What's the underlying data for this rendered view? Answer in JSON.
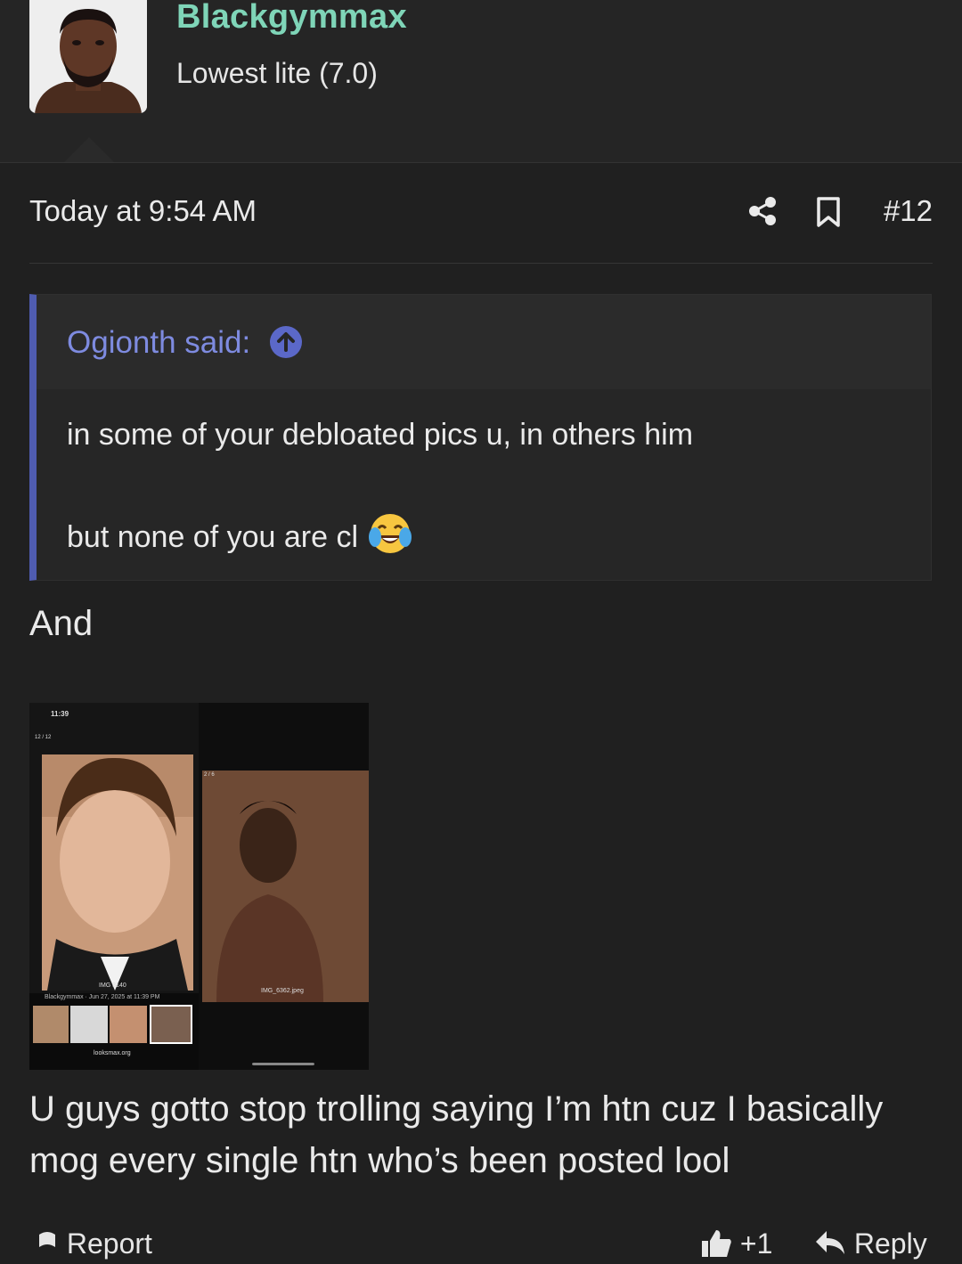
{
  "user": {
    "name": "Blackgymmax",
    "title": "Lowest lite (7.0)",
    "name_color": "#7fd5b8"
  },
  "post": {
    "timestamp": "Today at 9:54 AM",
    "number": "#12",
    "share_icon": "share-icon",
    "bookmark_icon": "bookmark-icon"
  },
  "quote": {
    "author": "Ogionth said:",
    "lines": [
      "in some of your debloated pics u, in others him",
      "but none of you are cl"
    ],
    "emoji": "face-with-tears-of-joy",
    "accent": "#4f5cb0"
  },
  "content": {
    "intro": "And",
    "body": "U guys gotto stop trolling saying I’m htn cuz I basically mog every single htn who’s been posted lool"
  },
  "attachment": {
    "status_time": "11:39",
    "counter_left": "12 / 12",
    "counter_right": "2 / 6",
    "caption_left": "IMG 3140",
    "meta_left": "Blackgymmax · Jun 27, 2025 at 11:39 PM",
    "caption_right": "IMG_6362.jpeg",
    "url": "looksmax.org"
  },
  "footer": {
    "report": "Report",
    "reactions": "+1",
    "reply": "Reply"
  }
}
